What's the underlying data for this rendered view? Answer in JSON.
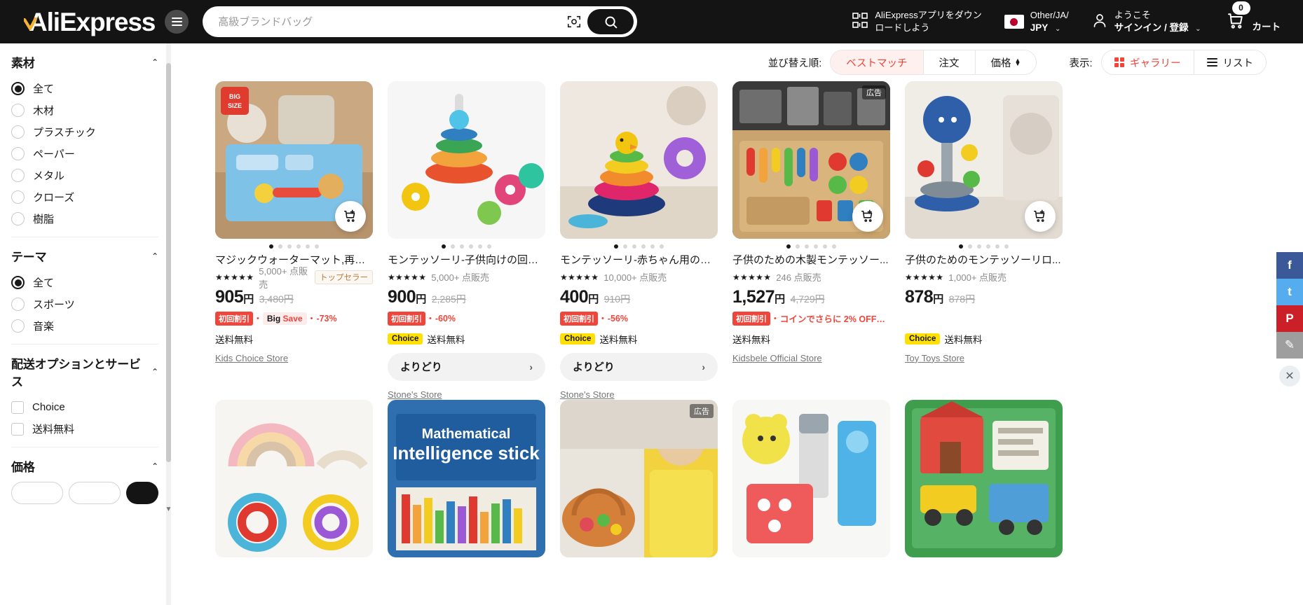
{
  "header": {
    "logo_text": "AliExpress",
    "menu_icon": "hamburger-icon",
    "search": {
      "placeholder": "高級ブランドバッグ",
      "value": "",
      "camera_icon": "camera-scan-icon",
      "search_icon": "search-icon"
    },
    "app_download": {
      "line1": "AliExpressアプリをダウン",
      "line2": "ロードしよう",
      "icon": "qr-code-icon"
    },
    "locale": {
      "line1": "Other/JA/",
      "line2": "JPY",
      "flag": "japan-flag-icon",
      "caret": "⌄"
    },
    "account": {
      "line1": "ようこそ",
      "line2": "サインイン / 登録",
      "icon": "user-icon",
      "caret": "⌄"
    },
    "cart": {
      "count": "0",
      "label": "カート",
      "icon": "cart-icon"
    }
  },
  "sidebar": {
    "groups": [
      {
        "title": "素材",
        "chevron": "⌃",
        "type": "radio",
        "options": [
          {
            "label": "全て",
            "selected": true
          },
          {
            "label": "木材",
            "selected": false
          },
          {
            "label": "プラスチック",
            "selected": false
          },
          {
            "label": "ペーパー",
            "selected": false
          },
          {
            "label": "メタル",
            "selected": false
          },
          {
            "label": "クローズ",
            "selected": false
          },
          {
            "label": "樹脂",
            "selected": false
          }
        ]
      },
      {
        "title": "テーマ",
        "chevron": "⌃",
        "type": "radio",
        "options": [
          {
            "label": "全て",
            "selected": true
          },
          {
            "label": "スポーツ",
            "selected": false
          },
          {
            "label": "音楽",
            "selected": false
          }
        ]
      },
      {
        "title": "配送オプションとサービス",
        "chevron": "⌃",
        "type": "checkbox",
        "options": [
          {
            "label": "Choice",
            "selected": false
          },
          {
            "label": "送料無料",
            "selected": false
          }
        ]
      },
      {
        "title": "価格",
        "chevron": "⌃",
        "type": "price",
        "options": []
      }
    ],
    "scroll_up": "▲",
    "scroll_down": "▼"
  },
  "toolbar": {
    "sort_label": "並び替え順:",
    "sort_options": [
      {
        "label": "ベストマッチ",
        "active": true
      },
      {
        "label": "注文",
        "active": false
      },
      {
        "label": "価格",
        "active": false,
        "has_arrows": true
      }
    ],
    "view_label": "表示:",
    "view_options": [
      {
        "label": "ギャラリー",
        "icon": "grid-icon",
        "active": true
      },
      {
        "label": "リスト",
        "icon": "list-icon",
        "active": false
      }
    ]
  },
  "products": [
    {
      "title": "マジックウォーターマット,再利...",
      "stars": "★★★★★",
      "sold": "5,000+ 点販売",
      "top_seller": "トップセラー",
      "price": "905",
      "currency": "円",
      "price_old": "3,480円",
      "badge_first": "初回割引",
      "badge_bigsave_pre": "Big",
      "badge_bigsave_em": "Save",
      "badge_pct": "-73%",
      "choice": "",
      "shipping": "送料無料",
      "bundle": "",
      "store": "Kids Choice Store",
      "has_cart_fab": true,
      "ad": "",
      "dots": 6,
      "img": "water-mat"
    },
    {
      "title": "モンテッソーリ-子供向けの回転...",
      "stars": "★★★★★",
      "sold": "5,000+ 点販売",
      "top_seller": "",
      "price": "900",
      "currency": "円",
      "price_old": "2,285円",
      "badge_first": "初回割引",
      "badge_bigsave_pre": "",
      "badge_bigsave_em": "",
      "badge_pct": "-60%",
      "choice": "Choice",
      "shipping": "送料無料",
      "bundle": "よりどり",
      "store": "Stone's Store",
      "has_cart_fab": false,
      "ad": "",
      "dots": 6,
      "img": "stack-rings"
    },
    {
      "title": "モンテッソーリ-赤ちゃん用のロ...",
      "stars": "★★★★★",
      "sold": "10,000+ 点販売",
      "top_seller": "",
      "price": "400",
      "currency": "円",
      "price_old": "910円",
      "badge_first": "初回割引",
      "badge_bigsave_pre": "",
      "badge_bigsave_em": "",
      "badge_pct": "-56%",
      "choice": "Choice",
      "shipping": "送料無料",
      "bundle": "よりどり",
      "store": "Stone's Store",
      "has_cart_fab": false,
      "ad": "",
      "dots": 6,
      "img": "rainbow-tower"
    },
    {
      "title": "子供のための木製モンテッソー...",
      "stars": "★★★★★",
      "sold": "246 点販売",
      "top_seller": "",
      "price": "1,527",
      "currency": "円",
      "price_old": "4,729円",
      "badge_first": "初回割引",
      "badge_bigsave_pre": "",
      "badge_bigsave_em": "",
      "badge_pct": "コインでさらに 2% OFF・ ...",
      "choice": "",
      "shipping": "送料無料",
      "bundle": "",
      "store": "Kidsbele Official Store",
      "has_cart_fab": true,
      "ad": "広告",
      "dots": 6,
      "img": "wooden-board"
    },
    {
      "title": "子供のためのモンテッソーリロ...",
      "stars": "★★★★★",
      "sold": "1,000+ 点販売",
      "top_seller": "",
      "price": "878",
      "currency": "円",
      "price_old": "878円",
      "badge_first": "",
      "badge_bigsave_pre": "",
      "badge_bigsave_em": "",
      "badge_pct": "",
      "choice": "Choice",
      "shipping": "送料無料",
      "bundle": "",
      "store": "Toy Toys Store",
      "has_cart_fab": true,
      "ad": "",
      "dots": 6,
      "img": "ball-drop"
    }
  ],
  "products_row2": [
    {
      "img": "rainbow-arch",
      "ad": ""
    },
    {
      "img": "math-sticks",
      "ad": ""
    },
    {
      "img": "picnic-basket",
      "ad": "広告"
    },
    {
      "img": "yellow-tools",
      "ad": ""
    },
    {
      "img": "busy-book",
      "ad": ""
    }
  ],
  "social": [
    {
      "name": "facebook-share",
      "glyph": "f",
      "color": "#3b5998"
    },
    {
      "name": "twitter-share",
      "glyph": "t",
      "color": "#55acee"
    },
    {
      "name": "pinterest-share",
      "glyph": "P",
      "color": "#cb2027"
    },
    {
      "name": "edit-share",
      "glyph": "✎",
      "color": "#9e9e9e"
    }
  ],
  "social_close": "✕",
  "colors": {
    "accent": "#f0453a",
    "dark": "#141414",
    "choice_yellow": "#ffe000"
  }
}
